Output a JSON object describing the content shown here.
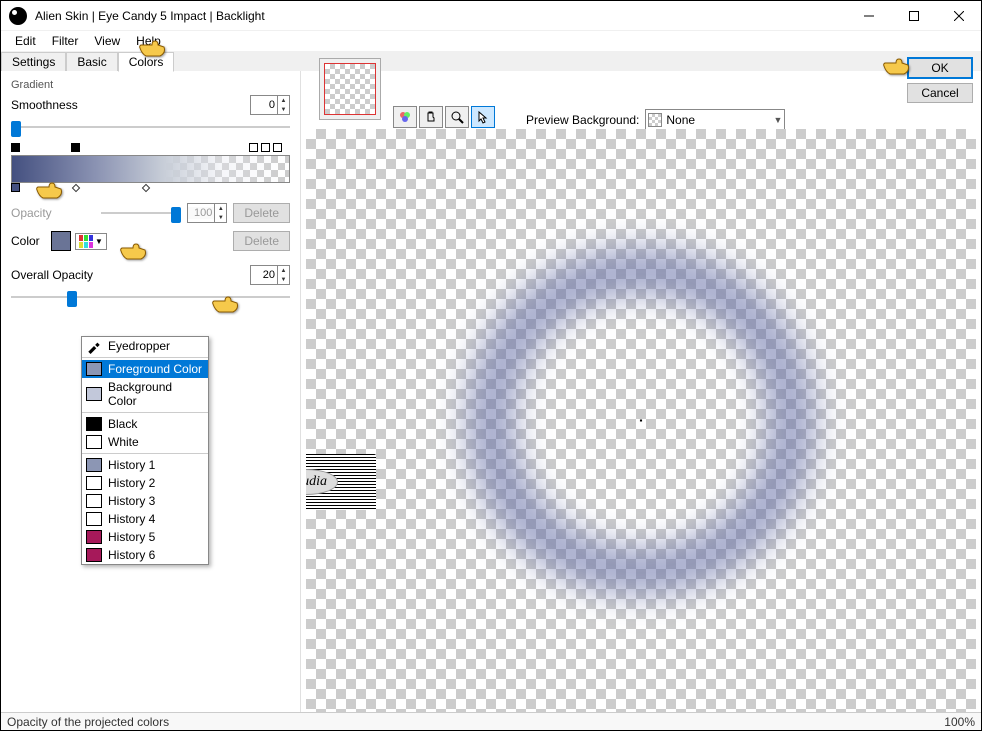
{
  "window": {
    "title": "Alien Skin | Eye Candy 5 Impact | Backlight"
  },
  "menubar": {
    "edit": "Edit",
    "filter": "Filter",
    "view": "View",
    "help": "Help"
  },
  "tabs": {
    "settings": "Settings",
    "basic": "Basic",
    "colors": "Colors"
  },
  "gradient": {
    "group": "Gradient",
    "smoothness_label": "Smoothness",
    "smoothness_value": "0",
    "opacity_label": "Opacity",
    "opacity_value": "100",
    "delete_btn": "Delete",
    "color_label": "Color",
    "overall_opacity_label": "Overall Opacity",
    "overall_opacity_value": "20"
  },
  "color_menu": {
    "eyedropper": "Eyedropper",
    "foreground": "Foreground Color",
    "background": "Background Color",
    "black": "Black",
    "white": "White",
    "history1": "History 1",
    "history2": "History 2",
    "history3": "History 3",
    "history4": "History 4",
    "history5": "History 5",
    "history6": "History 6"
  },
  "color_menu_swatches": {
    "foreground": "#8c96b4",
    "background": "#c2c8da",
    "black": "#000000",
    "white": "#ffffff",
    "history1": "#8c96b4",
    "history2": "#ffffff",
    "history3": "#ffffff",
    "history4": "#ffffff",
    "history5": "#a6195a",
    "history6": "#a6195a"
  },
  "preview": {
    "bg_label": "Preview Background:",
    "bg_value": "None"
  },
  "buttons": {
    "ok": "OK",
    "cancel": "Cancel"
  },
  "status": {
    "text": "Opacity of the projected colors",
    "zoom": "100%"
  },
  "watermark": {
    "text": "claudia"
  }
}
